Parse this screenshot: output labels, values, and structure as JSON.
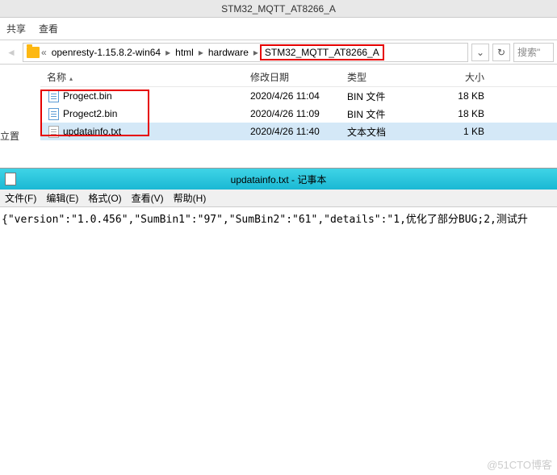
{
  "window_title": "STM32_MQTT_AT8266_A",
  "tabs": {
    "share": "共享",
    "view": "查看"
  },
  "breadcrumb": {
    "parts": [
      "openresty-1.15.8.2-win64",
      "html",
      "hardware",
      "STM32_MQTT_AT8266_A"
    ]
  },
  "search": {
    "placeholder": "搜索\""
  },
  "left_label": "立置",
  "columns": {
    "name": "名称",
    "date": "修改日期",
    "type": "类型",
    "size": "大小"
  },
  "files": [
    {
      "name": "Progect.bin",
      "date": "2020/4/26 11:04",
      "type": "BIN 文件",
      "size": "18 KB",
      "icon": "bin"
    },
    {
      "name": "Progect2.bin",
      "date": "2020/4/26 11:09",
      "type": "BIN 文件",
      "size": "18 KB",
      "icon": "bin"
    },
    {
      "name": "updatainfo.txt",
      "date": "2020/4/26 11:40",
      "type": "文本文档",
      "size": "1 KB",
      "icon": "txt",
      "selected": true
    }
  ],
  "notepad": {
    "title": "updatainfo.txt - 记事本",
    "menu": {
      "file": "文件(F)",
      "edit": "编辑(E)",
      "format": "格式(O)",
      "view": "查看(V)",
      "help": "帮助(H)"
    },
    "content": "{\"version\":\"1.0.456\",\"SumBin1\":\"97\",\"SumBin2\":\"61\",\"details\":\"1,优化了部分BUG;2,测试升"
  },
  "watermark": "@51CTO博客"
}
